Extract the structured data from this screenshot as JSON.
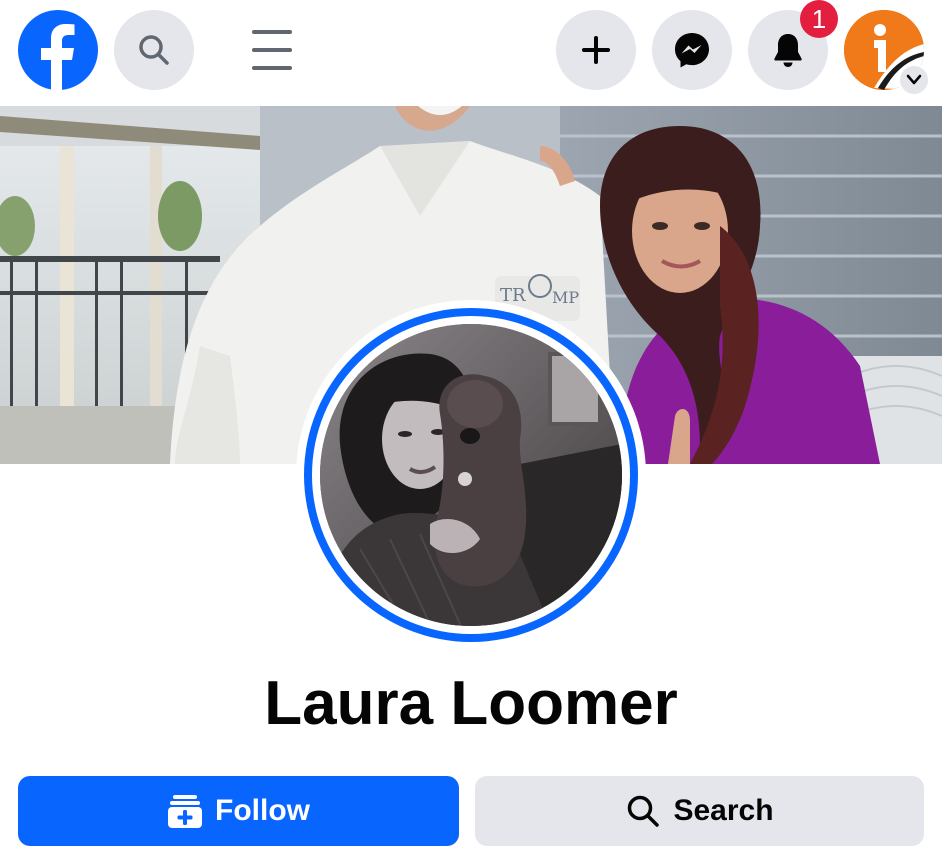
{
  "topbar": {
    "logo_icon": "facebook-logo-icon",
    "search_icon": "search-icon",
    "menu_icon": "hamburger-menu-icon",
    "create_icon": "plus-icon",
    "messenger_icon": "messenger-icon",
    "notifications_icon": "bell-icon",
    "notification_count": "1",
    "account_avatar_icon": "account-avatar",
    "account_menu_icon": "chevron-down-icon"
  },
  "profile": {
    "name": "Laura Loomer",
    "follow_label": "Follow",
    "follow_icon": "follow-plus-icon",
    "search_label": "Search",
    "search_icon": "search-icon"
  },
  "colors": {
    "brand_blue": "#0866ff",
    "button_gray": "#e4e6eb",
    "badge_red": "#e41e3f",
    "text_dark": "#050505"
  }
}
